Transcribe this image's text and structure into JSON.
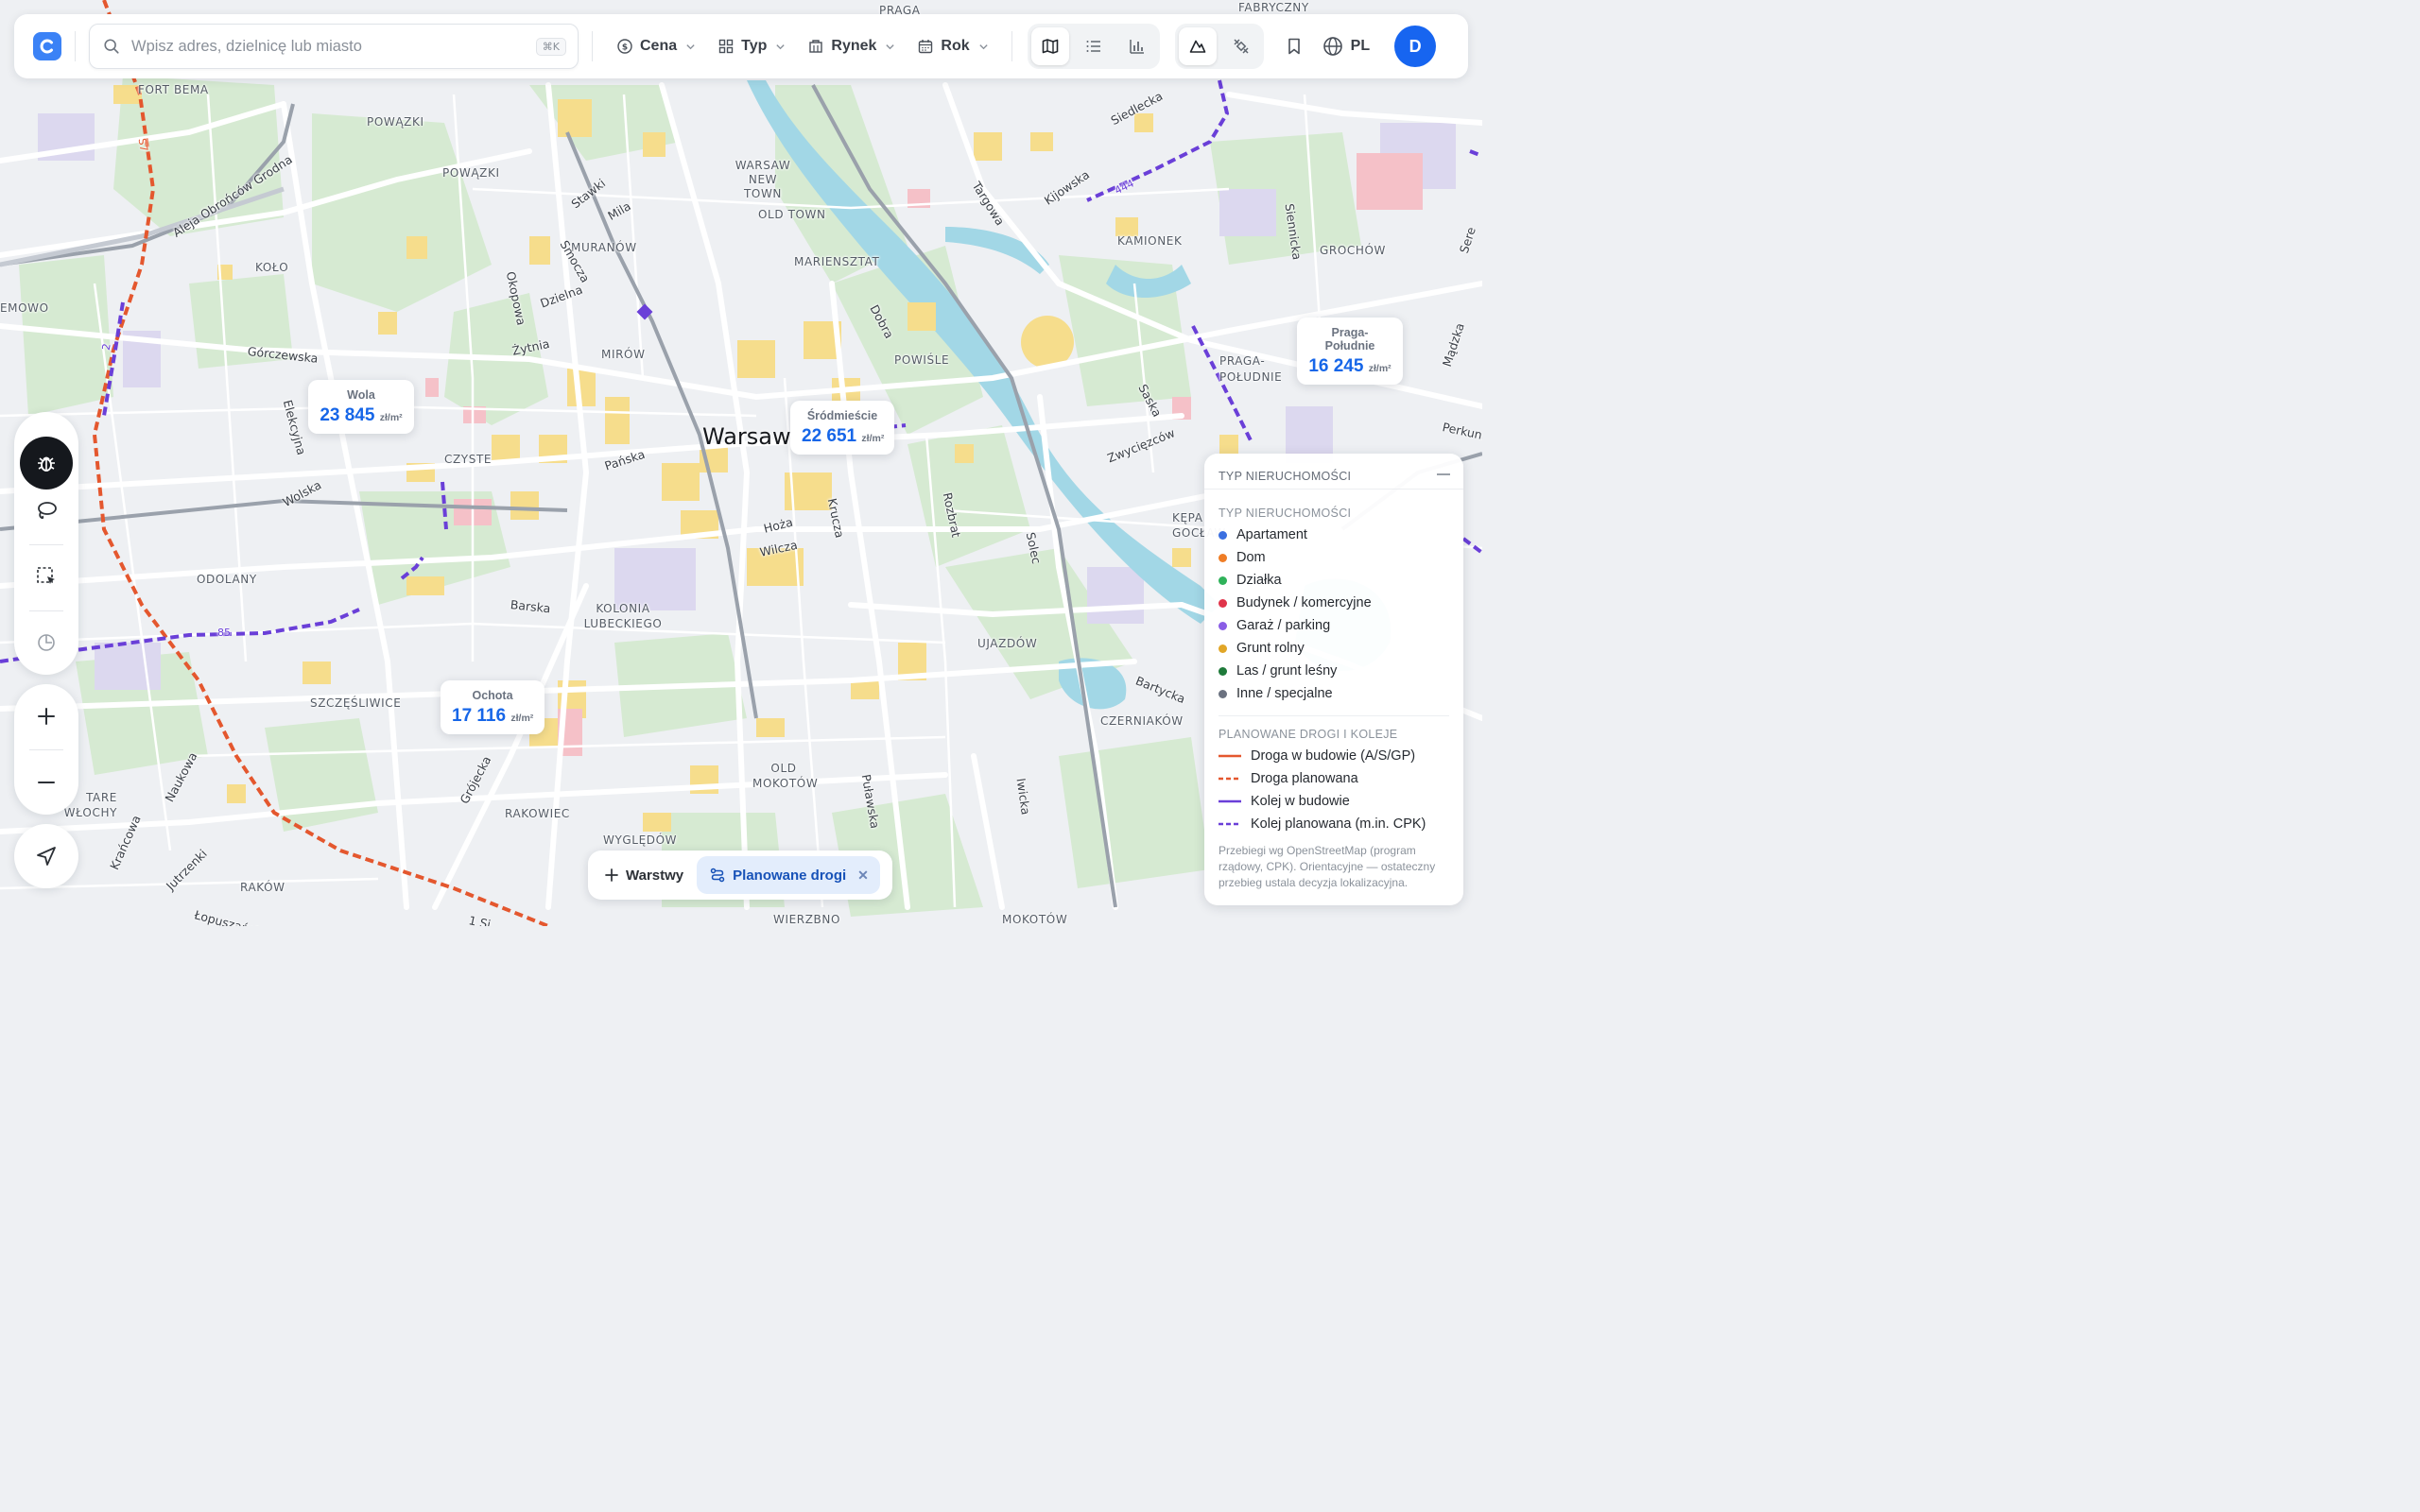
{
  "search": {
    "placeholder": "Wpisz adres, dzielnicę lub miasto",
    "shortcut": "⌘K"
  },
  "filters": [
    {
      "label": "Cena",
      "icon": "dollar-circle-icon"
    },
    {
      "label": "Typ",
      "icon": "grid-icon"
    },
    {
      "label": "Rynek",
      "icon": "building-icon"
    },
    {
      "label": "Rok",
      "icon": "calendar-icon"
    }
  ],
  "view_modes": [
    "map",
    "list",
    "chart"
  ],
  "active_view": "map",
  "layer_modes": [
    "terrain",
    "satellite"
  ],
  "language": "PL",
  "user": {
    "initial": "D"
  },
  "map": {
    "city": "Warsaw",
    "districts": [
      "PRAGA",
      "FABRYCZNY",
      "FORT BEMA",
      "POWĄZKI",
      "WARSAW NEW TOWN",
      "OLD TOWN",
      "MARIENSZTAT",
      "KAMIONEK",
      "GROCHÓW",
      "KOŁO",
      "MURANÓW",
      "MIRÓW",
      "POWIŚLE",
      "PRAGA-POŁUDNIE",
      "CZYSTE",
      "ODOLANY",
      "KOLONIA LUBECKIEGO",
      "UJAZDÓW",
      "SZCZĘŚLIWICE",
      "CZERNIAKÓW",
      "OLD MOKOTÓW",
      "RAKOWIEC",
      "TARE WŁOCHY",
      "WYGLĘDÓW",
      "RAKÓW",
      "KĘPA GOCŁAW",
      "MOKOTÓW",
      "WIERZBNO",
      "EMOWO"
    ],
    "streets": [
      "Aleja Obrońców Grodna",
      "Stawki",
      "Mila",
      "Smocza",
      "Dzielna",
      "Okopowa",
      "Żytnia",
      "Górczewska",
      "Elekcyjna",
      "Wolska",
      "Pańska",
      "Barska",
      "Hoża",
      "Wilcza",
      "Krucza",
      "Dobra",
      "Targowa",
      "Kijowska",
      "Siedlecka",
      "Saska",
      "Zwycięzców",
      "Rozbrat",
      "Solec",
      "Grójecka",
      "Naukowa",
      "Krańcowa",
      "Jutrzenki",
      "Puławska",
      "Iwicka",
      "Bartycka",
      "Łopuszańska",
      "Siennicka",
      "Mądzka",
      "Perkuna",
      "Sere"
    ],
    "route_labels": [
      "S7",
      "2",
      "85",
      "444",
      "1 Si"
    ]
  },
  "price_cards": [
    {
      "district": "Wola",
      "value": "23 845",
      "unit": "zł/m²"
    },
    {
      "district": "Śródmieście",
      "value": "22 651",
      "unit": "zł/m²"
    },
    {
      "district": "Praga-Południe",
      "value": "16 245",
      "unit": "zł/m²"
    },
    {
      "district": "Ochota",
      "value": "17 116",
      "unit": "zł/m²"
    }
  ],
  "legend": {
    "title": "TYP NIERUCHOMOŚCI",
    "section1": "TYP NIERUCHOMOŚCI",
    "property_types": [
      {
        "label": "Apartament",
        "color": "#3b6fe0"
      },
      {
        "label": "Dom",
        "color": "#ef7d26"
      },
      {
        "label": "Działka",
        "color": "#2fb25a"
      },
      {
        "label": "Budynek / komercyjne",
        "color": "#e0344a"
      },
      {
        "label": "Garaż / parking",
        "color": "#8a5de6"
      },
      {
        "label": "Grunt rolny",
        "color": "#e1a627"
      },
      {
        "label": "Las / grunt leśny",
        "color": "#1f7a3a"
      },
      {
        "label": "Inne / specjalne",
        "color": "#6b7280"
      }
    ],
    "section2": "PLANOWANE DROGI I KOLEJE",
    "routes": [
      {
        "label": "Droga w budowie (A/S/GP)",
        "color": "#e4572e",
        "dashed": false
      },
      {
        "label": "Droga planowana",
        "color": "#e4572e",
        "dashed": true
      },
      {
        "label": "Kolej w budowie",
        "color": "#6a3fd8",
        "dashed": false
      },
      {
        "label": "Kolej planowana (m.in. CPK)",
        "color": "#6a3fd8",
        "dashed": true
      }
    ],
    "note": "Przebiegi wg OpenStreetMap (program rządowy, CPK). Orientacyjne — ostateczny przebieg ustala decyzja lokalizacyjna."
  },
  "bottom_bar": {
    "layers_label": "Warstwy",
    "chip_label": "Planowane drogi"
  },
  "colors": {
    "accent": "#1765f0",
    "road_planned": "#e4572e",
    "rail_planned": "#6a3fd8",
    "water": "#9fd6e6",
    "park": "#d4ebd0",
    "residential_yellow": "#f5df8f"
  }
}
